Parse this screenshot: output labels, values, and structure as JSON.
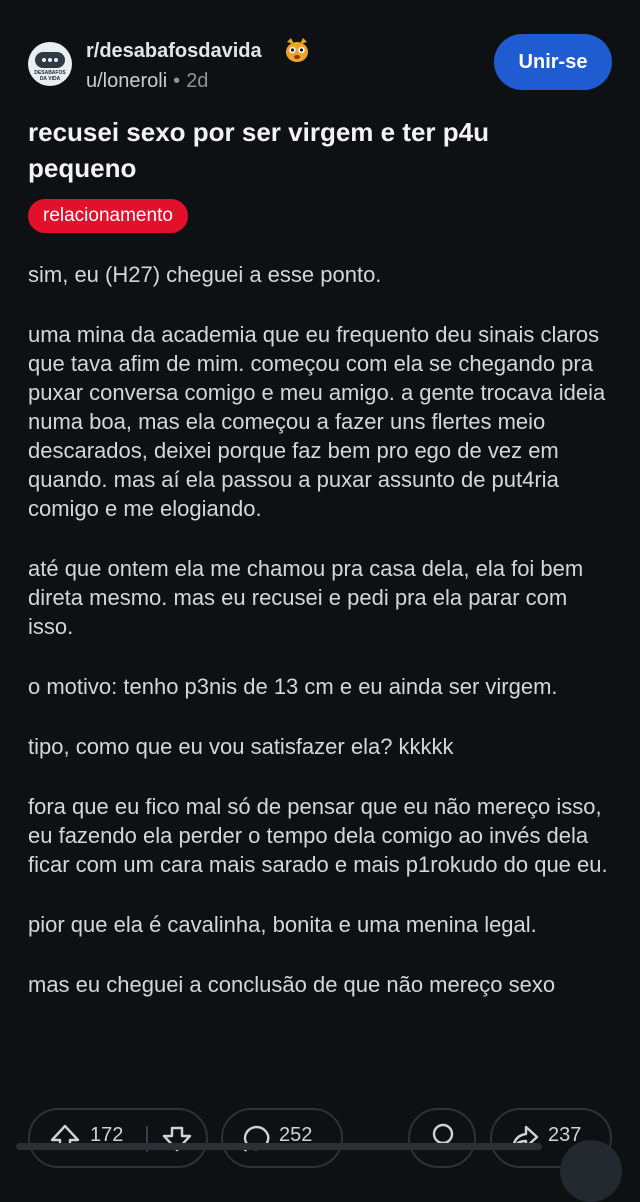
{
  "header": {
    "subreddit": "r/desabafosdavida",
    "avatar_caption": "DESABAFOS DA VIDA",
    "user": "u/loneroli",
    "separator": "•",
    "age": "2d",
    "join_label": "Unir-se"
  },
  "post": {
    "title": "recusei sexo por ser virgem e ter p4u pequeno",
    "flair": "relacionamento",
    "paragraphs": [
      "sim, eu (H27) cheguei a esse ponto.",
      "uma mina da academia que eu frequento deu sinais claros que tava afim de mim. começou com ela se chegando pra puxar conversa comigo e meu amigo. a gente trocava ideia numa boa, mas ela começou a fazer uns flertes meio descarados, deixei porque faz bem pro ego de vez em quando. mas aí ela passou a puxar assunto de put4ria comigo e me elogiando.",
      "até que ontem ela me chamou pra casa dela, ela foi bem direta mesmo. mas eu recusei e pedi pra ela parar com isso.",
      "o motivo: tenho p3nis de 13 cm e eu ainda ser virgem.",
      "tipo, como que eu vou satisfazer ela? kkkkk",
      "fora que eu fico mal só de pensar que eu não mereço isso, eu fazendo ela perder o tempo dela comigo ao invés dela ficar com um cara mais sarado e mais p1rokudo do que eu.",
      "pior que ela é cavalinha, bonita e uma menina legal.",
      "mas eu cheguei a conclusão de que não mereço sexo"
    ]
  },
  "actions": {
    "upvotes": "172",
    "comments": "252",
    "shares": "237"
  },
  "colors": {
    "background": "#0e1113",
    "join_button": "#1f5bd1",
    "flair": "#e3102c"
  },
  "icons": {
    "upvote": "arrow-up-icon",
    "downvote": "arrow-down-icon",
    "comment": "comment-bubble-icon",
    "award": "award-icon",
    "share": "share-icon",
    "mascot": "cat-mascot-icon"
  }
}
